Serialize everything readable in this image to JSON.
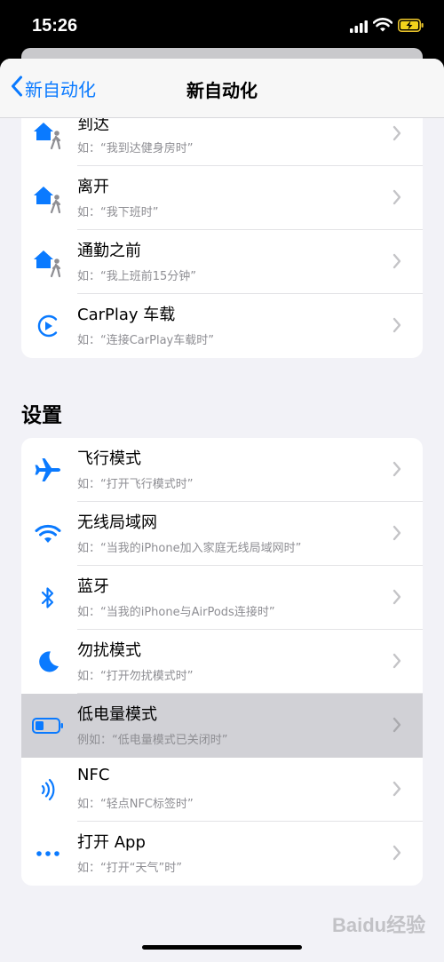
{
  "status_bar": {
    "time": "15:26"
  },
  "nav": {
    "back_label": "新自动化",
    "title": "新自动化"
  },
  "section_settings": {
    "header": "设置"
  },
  "travel_items": [
    {
      "title": "到达",
      "subtitle": "如：“我到达健身房时”",
      "icon": "home-person-icon"
    },
    {
      "title": "离开",
      "subtitle": "如：“我下班时”",
      "icon": "home-person-icon"
    },
    {
      "title": "通勤之前",
      "subtitle": "如：“我上班前15分钟”",
      "icon": "home-person-icon"
    },
    {
      "title": "CarPlay 车载",
      "subtitle": "如：“连接CarPlay车载时”",
      "icon": "carplay-icon"
    }
  ],
  "settings_items": [
    {
      "title": "飞行模式",
      "subtitle": "如：“打开飞行模式时”",
      "icon": "airplane-icon"
    },
    {
      "title": "无线局域网",
      "subtitle": "如：“当我的iPhone加入家庭无线局域网时”",
      "icon": "wifi-icon"
    },
    {
      "title": "蓝牙",
      "subtitle": "如：“当我的iPhone与AirPods连接时”",
      "icon": "bluetooth-icon"
    },
    {
      "title": "勿扰模式",
      "subtitle": "如：“打开勿扰模式时”",
      "icon": "moon-icon"
    },
    {
      "title": "低电量模式",
      "subtitle": "例如：“低电量模式已关闭时”",
      "icon": "battery-icon",
      "highlighted": true
    },
    {
      "title": "NFC",
      "subtitle": "如：“轻点NFC标签时”",
      "icon": "nfc-icon"
    },
    {
      "title": "打开 App",
      "subtitle": "如：“打开“天气”时”",
      "icon": "ellipsis-icon"
    }
  ],
  "watermark": "Baidu经验",
  "colors": {
    "accent": "#0a7aff",
    "background": "#f2f2f7",
    "highlight": "#d1d1d6",
    "subtitle": "#8e8e93"
  }
}
